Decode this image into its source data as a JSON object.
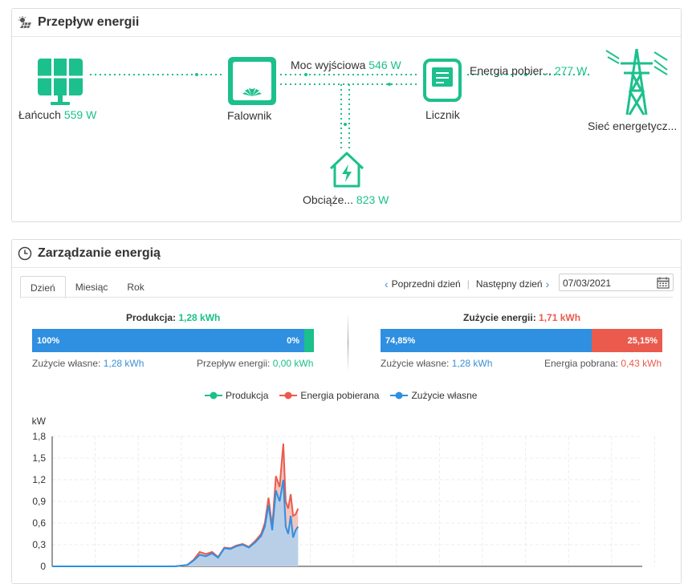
{
  "energy_flow": {
    "title": "Przepływ energii",
    "string_label": "Łańcuch",
    "string_value": "559 W",
    "inverter_label": "Falownik",
    "output_label": "Moc wyjściowa",
    "output_value": "546 W",
    "meter_label": "Licznik",
    "import_label": "Energia pobier...",
    "import_value": "277 W",
    "grid_label": "Sieć energetycz...",
    "load_label": "Obciąże...",
    "load_value": "823 W"
  },
  "management": {
    "title": "Zarządzanie energią",
    "tabs": [
      "Dzień",
      "Miesiąc",
      "Rok"
    ],
    "active_tab": "Dzień",
    "prev_day": "Poprzedni dzień",
    "next_day": "Następny dzień",
    "date": "07/03/2021",
    "production": {
      "title": "Produkcja:",
      "value": "1,28 kWh",
      "left_pct": "100%",
      "right_pct": "0%",
      "self_use_label": "Zużycie własne:",
      "self_use_value": "1,28 kWh",
      "export_label": "Przepływ energii:",
      "export_value": "0,00 kWh",
      "fill_fraction": 1.0
    },
    "consumption": {
      "title": "Zużycie energii:",
      "value": "1,71 kWh",
      "left_pct": "74,85%",
      "right_pct": "25,15%",
      "self_use_label": "Zużycie własne:",
      "self_use_value": "1,28 kWh",
      "import_label": "Energia pobrana:",
      "import_value": "0,43 kWh",
      "fill_fraction": 0.7485
    },
    "colors": {
      "green": "#1cc08c",
      "blue": "#2f8fe0",
      "red": "#ea5b4d"
    }
  },
  "chart_data": {
    "type": "area",
    "ylabel": "kW",
    "ylim": [
      0,
      1.8
    ],
    "yticks": [
      "0",
      "0,3",
      "0,6",
      "0,9",
      "1,2",
      "1,5",
      "1,8"
    ],
    "legend": [
      "Produkcja",
      "Energia pobierana",
      "Zużycie własne"
    ],
    "series": [
      {
        "name": "Zużycie własne",
        "x": [
          0,
          5,
          10,
          11,
          11.5,
          12,
          12.5,
          13,
          13.5,
          14,
          14.5,
          15,
          15.5,
          16,
          16.5,
          17,
          17.3,
          17.6,
          17.9,
          18.2,
          18.5,
          18.8,
          19,
          19.2,
          19.4,
          19.6,
          19.8,
          20
        ],
        "values": [
          0,
          0,
          0,
          0.02,
          0.08,
          0.16,
          0.14,
          0.18,
          0.12,
          0.25,
          0.24,
          0.28,
          0.3,
          0.26,
          0.33,
          0.42,
          0.55,
          0.85,
          0.5,
          1.05,
          0.9,
          1.2,
          0.55,
          0.45,
          0.7,
          0.4,
          0.5,
          0.55
        ]
      },
      {
        "name": "Energia pobierana",
        "x": [
          0,
          5,
          10,
          11,
          11.5,
          12,
          12.5,
          13,
          13.5,
          14,
          14.5,
          15,
          15.5,
          16,
          16.5,
          17,
          17.3,
          17.6,
          17.9,
          18.2,
          18.5,
          18.8,
          19,
          19.2,
          19.4,
          19.6,
          19.8,
          20
        ],
        "values": [
          0,
          0,
          0,
          0.02,
          0.09,
          0.2,
          0.17,
          0.2,
          0.13,
          0.26,
          0.25,
          0.29,
          0.31,
          0.27,
          0.35,
          0.45,
          0.6,
          0.95,
          0.55,
          1.25,
          1.1,
          1.7,
          0.9,
          0.8,
          1.0,
          0.7,
          0.72,
          0.8
        ]
      }
    ]
  }
}
